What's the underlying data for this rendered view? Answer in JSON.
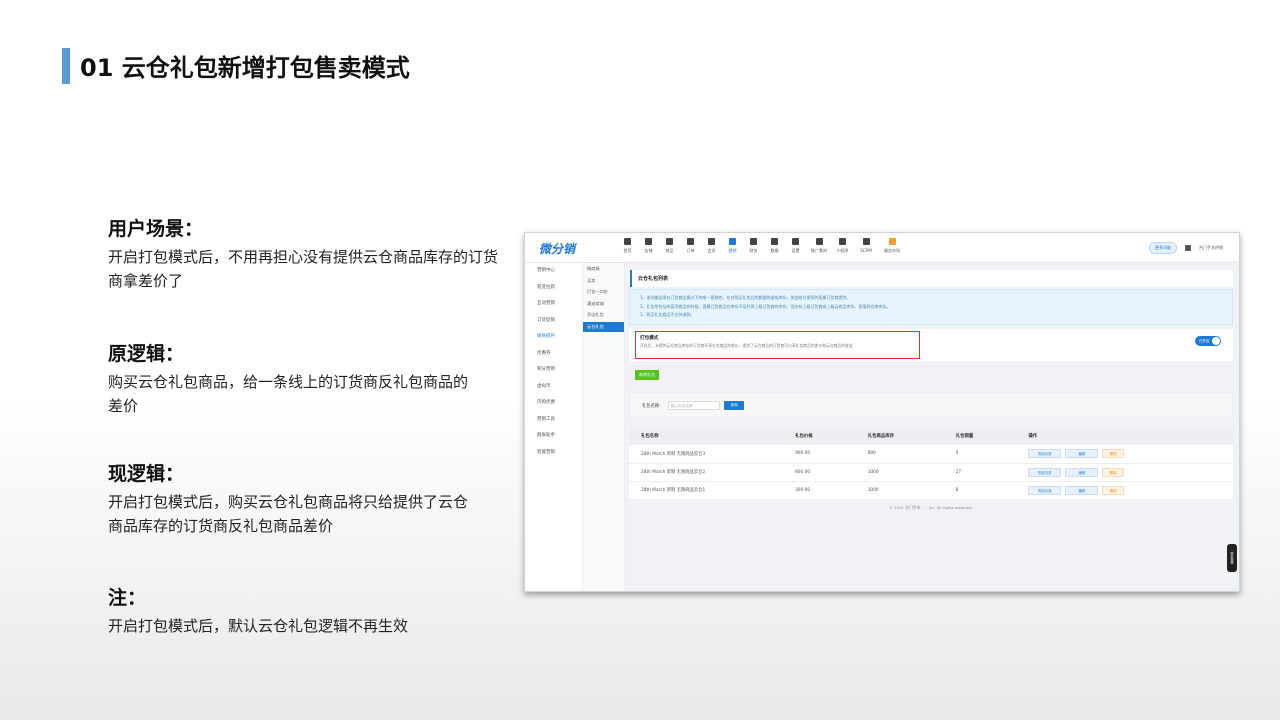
{
  "slide": {
    "title": "01 云仓礼包新增打包售卖模式"
  },
  "sections": [
    {
      "heading": "用户场景：",
      "body": "开启打包模式后，不用再担心没有提供云仓商品库存的订货商拿差价了"
    },
    {
      "heading": "原逻辑：",
      "body": "购买云仓礼包商品，给一条线上的订货商反礼包商品的差价"
    },
    {
      "heading": "现逻辑：",
      "body": "开启打包模式后，购买云仓礼包商品将只给提供了云仓商品库存的订货商反礼包商品差价"
    },
    {
      "heading": "注：",
      "body": "开启打包模式后，默认云仓礼包逻辑不再生效"
    }
  ],
  "app": {
    "logo": "微分销",
    "nav": [
      "首页",
      "店铺",
      "商品",
      "订单",
      "会员",
      "营销",
      "财务",
      "数据",
      "设置",
      "推广素材",
      "小程序",
      "SCRM",
      "服务市场"
    ],
    "nav_active": 5,
    "top_pill": "更多功能",
    "account": "台门手木供销",
    "side1": [
      "营销中心",
      "裂变拉新",
      "互动营销",
      "订货促销",
      "微商提升",
      "优惠券",
      "积分营销",
      "虚拟币",
      "内购优惠",
      "营销工具",
      "群发助手",
      "智能营销"
    ],
    "side1_active": 4,
    "side2": [
      "微商城",
      "买卖",
      "打包一口价",
      "满送商城",
      "开店礼包",
      "云仓礼包"
    ],
    "side2_active": 5,
    "page_title": "云仓礼包列表",
    "notices": [
      "1、该功能适用在订货商品模式下的唯一营销性，在对购买礼包后的数据的虚拟库存，协会给方便您的直属订货商提供。",
      "2、礼包所包括的某项商品的时候，直属订货商品在库存不足时将上级订货商的库存，但应有上级订货商或上级云商品库存，直接扣仓库库存。",
      "3、购买礼包商品不支持退款。"
    ],
    "pack_mode": {
      "title": "打包模式",
      "desc": "开启后，未提供云仓商品库存的订货商不享礼包商品的差价，提供了云仓商品的订货商可以享礼包商品的差价和云仓商品的收益",
      "toggle_label": "已开启"
    },
    "add_button": "新增礼包",
    "search": {
      "label": "礼包名称:",
      "placeholder": "输入礼包名称",
      "button": "查询"
    },
    "table": {
      "headers": [
        "礼包名称",
        "礼包价格",
        "礼包商品库存",
        "礼包销量",
        "操作"
      ],
      "rows": [
        [
          "28th March 新制 无限商品云仓3",
          "900.00",
          "890",
          "4"
        ],
        [
          "28th March 新制 无限商品云仓2",
          "800.00",
          "1000",
          "27"
        ],
        [
          "28th March 新制 无限商品云仓1",
          "300.00",
          "1000",
          "8"
        ]
      ],
      "ops": [
        "购买记录",
        "编辑",
        "删除"
      ]
    },
    "footer": "© 2021 台门手木 · · , Inc. All rights reserved.",
    "float_label": "联系客服"
  }
}
